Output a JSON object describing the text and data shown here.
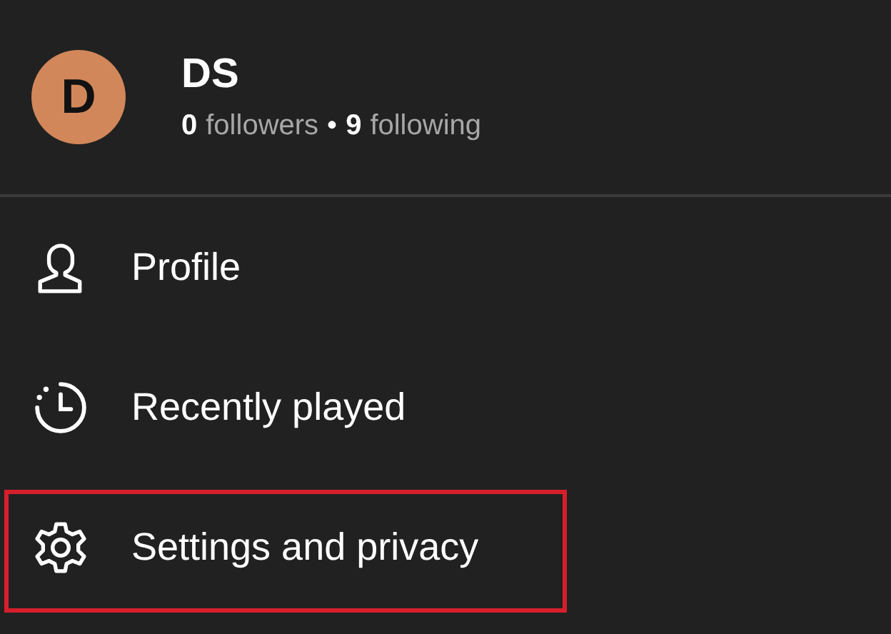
{
  "profile": {
    "avatar_letter": "D",
    "name": "DS",
    "followers_count": "0",
    "followers_label": "followers",
    "separator": "•",
    "following_count": "9",
    "following_label": "following"
  },
  "menu": [
    {
      "kind": "profile",
      "label": "Profile",
      "highlighted": false
    },
    {
      "kind": "history",
      "label": "Recently played",
      "highlighted": false
    },
    {
      "kind": "settings",
      "label": "Settings and privacy",
      "highlighted": true
    }
  ]
}
